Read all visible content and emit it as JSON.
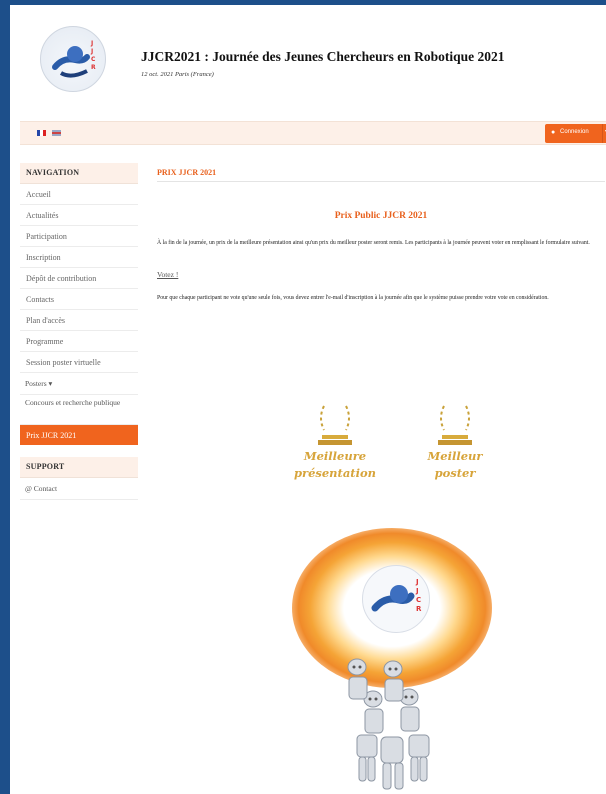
{
  "header": {
    "title": "JJCR2021 : Journée des Jeunes Chercheurs en Robotique 2021",
    "subtitle": "12 oct. 2021 Paris (France)",
    "logo_text": "JJCR 2021"
  },
  "topbar": {
    "languages": [
      "fr-flag-icon",
      "en-flag-icon"
    ],
    "login_label": "Connexion",
    "login_icon": "user-icon",
    "accent_color": "#f0641e"
  },
  "sidebar": {
    "navigation_heading": "NAVIGATION",
    "items": [
      {
        "label": "Accueil"
      },
      {
        "label": "Actualités"
      },
      {
        "label": "Participation"
      },
      {
        "label": "Inscription"
      },
      {
        "label": "Dépôt de contribution"
      },
      {
        "label": "Contacts"
      },
      {
        "label": "Plan d'accès"
      },
      {
        "label": "Programme"
      },
      {
        "label": "Session poster virtuelle"
      },
      {
        "label": "Posters ▾"
      },
      {
        "label": "Concours et recherche publique"
      },
      {
        "label": "Prix JJCR 2021",
        "active": true
      }
    ],
    "support_heading": "SUPPORT",
    "support_items": [
      {
        "label": "@ Contact"
      }
    ]
  },
  "main": {
    "page_title": "PRIX JJCR 2021",
    "section_title": "Prix Public JJCR 2021",
    "paragraph1": "À la fin de la journée, un prix de la meilleure présentation ainsi qu'un prix du meilleur poster seront remis. Les participants à la journée peuvent voter en remplissant le formulaire suivant.",
    "vote_link": "Votez !",
    "paragraph2": "Pour que chaque participant ne vote qu'une seule fois, vous devez entrer l'e-mail d'inscription à la journée afin que le système puisse prendre votre vote en considération.",
    "awards": [
      {
        "line1": "Meilleure",
        "line2": "présentation"
      },
      {
        "line1": "Meilleur",
        "line2": "poster"
      }
    ],
    "poster_logo_text": "JJCR 2021"
  }
}
